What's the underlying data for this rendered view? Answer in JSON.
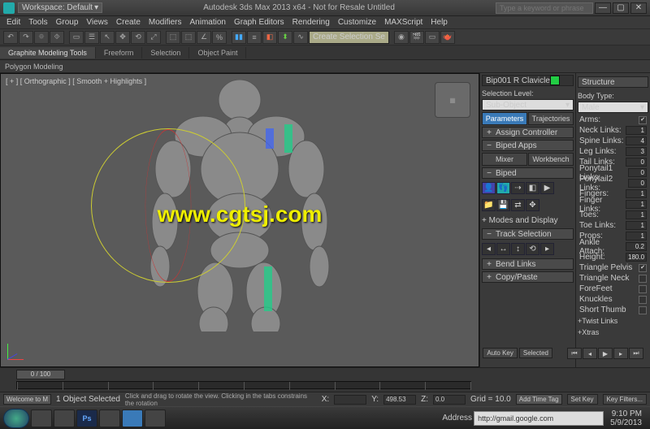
{
  "titlebar": {
    "workspace_label": "Workspace: Default",
    "title": "Autodesk 3ds Max 2013 x64 - Not for Resale   Untitled",
    "search_placeholder": "Type a keyword or phrase"
  },
  "menu": [
    "Edit",
    "Tools",
    "Group",
    "Views",
    "Create",
    "Modifiers",
    "Animation",
    "Graph Editors",
    "Rendering",
    "Customize",
    "MAXScript",
    "Help"
  ],
  "ribbon": {
    "tabs": [
      "Graphite Modeling Tools",
      "Freeform",
      "Selection",
      "Object Paint"
    ],
    "sub": "Polygon Modeling"
  },
  "viewport": {
    "label": "[ + ] [ Orthographic ] [ Smooth + Highlights ]"
  },
  "watermark": "www.cgtsj.com",
  "cmd": {
    "object_name": "Bip001 R Clavicle",
    "selection_level_label": "Selection Level:",
    "sub_object": "Sub-Object",
    "parameters": "Parameters",
    "trajectories": "Trajectories",
    "assign_controller": "Assign Controller",
    "biped_apps": "Biped Apps",
    "mixer": "Mixer",
    "workbench": "Workbench",
    "biped": "Biped",
    "modes": "Modes and Display",
    "track": "Track Selection",
    "bend": "Bend Links",
    "copypaste": "Copy/Paste"
  },
  "structure": {
    "title": "Structure",
    "body_type_label": "Body Type:",
    "body_type": "Male",
    "rows": [
      {
        "label": "Arms:",
        "type": "chk",
        "val": true
      },
      {
        "label": "Neck Links:",
        "type": "spin",
        "val": "1"
      },
      {
        "label": "Spine Links:",
        "type": "spin",
        "val": "4"
      },
      {
        "label": "Leg Links:",
        "type": "spin",
        "val": "3"
      },
      {
        "label": "Tail Links:",
        "type": "spin",
        "val": "0"
      },
      {
        "label": "Ponytail1 Links:",
        "type": "spin",
        "val": "0"
      },
      {
        "label": "Ponytail2 Links:",
        "type": "spin",
        "val": "0"
      },
      {
        "label": "Fingers:",
        "type": "spin",
        "val": "1"
      },
      {
        "label": "Finger Links:",
        "type": "spin",
        "val": "1"
      },
      {
        "label": "Toes:",
        "type": "spin",
        "val": "1"
      },
      {
        "label": "Toe Links:",
        "type": "spin",
        "val": "1"
      },
      {
        "label": "Props:",
        "type": "spin",
        "val": "1"
      },
      {
        "label": "Ankle Attach:",
        "type": "spin",
        "val": "0.2"
      },
      {
        "label": "Height:",
        "type": "spin",
        "val": "180.0"
      },
      {
        "label": "Triangle Pelvis",
        "type": "chk",
        "val": true
      },
      {
        "label": "Triangle Neck",
        "type": "chk",
        "val": false
      },
      {
        "label": "ForeFeet",
        "type": "chk",
        "val": false
      },
      {
        "label": "Knuckles",
        "type": "chk",
        "val": false
      },
      {
        "label": "Short Thumb",
        "type": "chk",
        "val": false
      }
    ],
    "twist": "+Twist Links",
    "xtras": "+Xtras"
  },
  "create_dropdown": "Create Selection Se",
  "timeline": {
    "slider": "0 / 100"
  },
  "status": {
    "welcome": "Welcome to M",
    "selected": "1 Object Selected",
    "hint": "Click and drag to rotate the view.  Clicking in the tabs constrains the rotation",
    "x": "X:",
    "y": "Y:",
    "z": "Z:",
    "yval": "498.53",
    "zval": "0.0",
    "grid": "Grid = 10.0",
    "autokey": "Auto Key",
    "setkey": "Set Key",
    "selected_filter": "Selected",
    "keyfilters": "Key Filters...",
    "addtag": "Add Time Tag"
  },
  "taskbar": {
    "addr_label": "Address",
    "addr": "http://gmail.google.com",
    "time": "9:10 PM",
    "date": "5/9/2013",
    "ps": "Ps"
  }
}
